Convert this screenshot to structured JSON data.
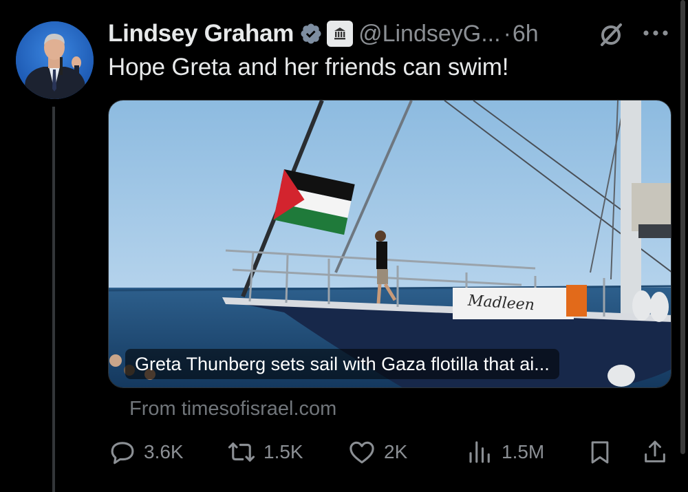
{
  "tweet": {
    "author_name": "Lindsey Graham",
    "handle": "@LindseyG...",
    "separator": "·",
    "time": "6h",
    "text": "Hope Greta and her friends can swim!"
  },
  "card": {
    "title": "Greta Thunberg sets sail with Gaza flotilla that ai...",
    "boat_name": "Madleen",
    "source": "From timesofisrael.com"
  },
  "actions": {
    "replies": "3.6K",
    "reposts": "1.5K",
    "likes": "2K",
    "views": "1.5M"
  },
  "icons": {
    "verified": "verified-checkmark-icon",
    "government": "government-building-icon",
    "grok": "grok-icon",
    "more": "more-dots-icon",
    "reply": "reply-bubble-icon",
    "repost": "repost-arrows-icon",
    "like": "heart-icon",
    "views": "bar-chart-icon",
    "bookmark": "bookmark-icon",
    "share": "share-icon"
  },
  "colors": {
    "background": "#000000",
    "text": "#e7e9ea",
    "secondary": "#71767b",
    "verified_blue": "#1d9bf0"
  }
}
